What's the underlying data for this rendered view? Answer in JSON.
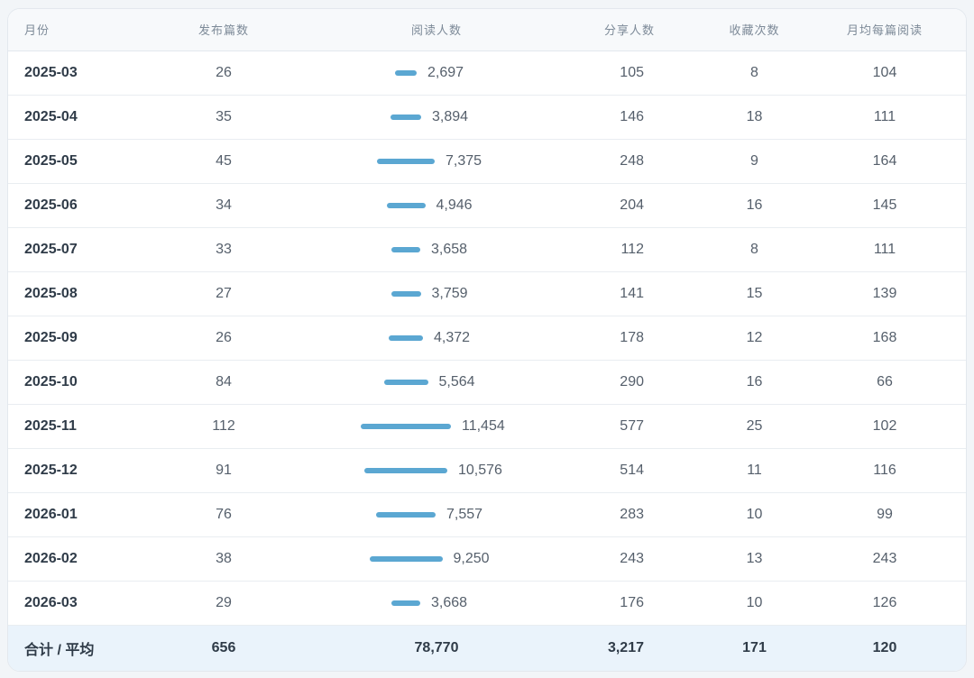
{
  "columns": [
    "月份",
    "发布篇数",
    "阅读人数",
    "分享人数",
    "收藏次数",
    "月均每篇阅读"
  ],
  "bar_color": "#5ba7d2",
  "bar_max": 11454,
  "rows": [
    {
      "month": "2025-03",
      "posts": "26",
      "reads": "2,697",
      "reads_value": 2697,
      "shares": "105",
      "favs": "8",
      "avg": "104"
    },
    {
      "month": "2025-04",
      "posts": "35",
      "reads": "3,894",
      "reads_value": 3894,
      "shares": "146",
      "favs": "18",
      "avg": "111"
    },
    {
      "month": "2025-05",
      "posts": "45",
      "reads": "7,375",
      "reads_value": 7375,
      "shares": "248",
      "favs": "9",
      "avg": "164"
    },
    {
      "month": "2025-06",
      "posts": "34",
      "reads": "4,946",
      "reads_value": 4946,
      "shares": "204",
      "favs": "16",
      "avg": "145"
    },
    {
      "month": "2025-07",
      "posts": "33",
      "reads": "3,658",
      "reads_value": 3658,
      "shares": "112",
      "favs": "8",
      "avg": "111"
    },
    {
      "month": "2025-08",
      "posts": "27",
      "reads": "3,759",
      "reads_value": 3759,
      "shares": "141",
      "favs": "15",
      "avg": "139"
    },
    {
      "month": "2025-09",
      "posts": "26",
      "reads": "4,372",
      "reads_value": 4372,
      "shares": "178",
      "favs": "12",
      "avg": "168"
    },
    {
      "month": "2025-10",
      "posts": "84",
      "reads": "5,564",
      "reads_value": 5564,
      "shares": "290",
      "favs": "16",
      "avg": "66"
    },
    {
      "month": "2025-11",
      "posts": "112",
      "reads": "11,454",
      "reads_value": 11454,
      "shares": "577",
      "favs": "25",
      "avg": "102"
    },
    {
      "month": "2025-12",
      "posts": "91",
      "reads": "10,576",
      "reads_value": 10576,
      "shares": "514",
      "favs": "11",
      "avg": "116"
    },
    {
      "month": "2026-01",
      "posts": "76",
      "reads": "7,557",
      "reads_value": 7557,
      "shares": "283",
      "favs": "10",
      "avg": "99"
    },
    {
      "month": "2026-02",
      "posts": "38",
      "reads": "9,250",
      "reads_value": 9250,
      "shares": "243",
      "favs": "13",
      "avg": "243"
    },
    {
      "month": "2026-03",
      "posts": "29",
      "reads": "3,668",
      "reads_value": 3668,
      "shares": "176",
      "favs": "10",
      "avg": "126"
    }
  ],
  "total": {
    "label": "合计 / 平均",
    "posts": "656",
    "reads": "78,770",
    "shares": "3,217",
    "favs": "171",
    "avg": "120"
  }
}
